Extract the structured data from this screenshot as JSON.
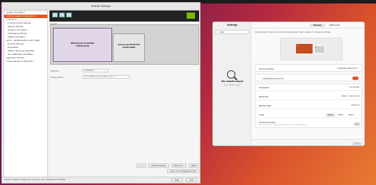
{
  "nvidia": {
    "title": "NVIDIA Settings",
    "sidebar": [
      {
        "label": "System Information",
        "level": 1
      },
      {
        "label": "X Server Display Configuration",
        "level": 1,
        "selected": true
      },
      {
        "label": "X Screen 0",
        "level": 1
      },
      {
        "label": "X Server XVideo Settings",
        "level": 2
      },
      {
        "label": "OpenGL Settings",
        "level": 2
      },
      {
        "label": "Graphics Information",
        "level": 2
      },
      {
        "label": "Antialiasing Settings",
        "level": 2
      },
      {
        "label": "VDPAU Information",
        "level": 2
      },
      {
        "label": "GPU 0 - (NVIDIA GeForce GTX 1660)",
        "level": 1
      },
      {
        "label": "Thermal Settings",
        "level": 2
      },
      {
        "label": "PowerMizer",
        "level": 2
      },
      {
        "label": "HDMI-1 (Samsung S24C550)",
        "level": 2
      },
      {
        "label": "DP-1 (BNQ BenQ PL2460Q)",
        "level": 2
      },
      {
        "label": "Application Profiles",
        "level": 1
      },
      {
        "label": "nvidia-settings Configuration",
        "level": 1
      }
    ],
    "layout_label": "Layout",
    "display1": {
      "name": "BNQ BenQ PL2460Q",
      "res": "2560x1440"
    },
    "display2": {
      "name": "Samsung S24C550",
      "res": "1920x1080"
    },
    "selection_label": "Selection:",
    "selection_value": "X screen 0",
    "configuration_label": "Configuration:",
    "model_value": "DP-1 (BNQ BenQ PL2460Q) (DP-1)",
    "buttons": {
      "apply": "Apply",
      "detect": "Detect Displays",
      "advanced": "Advanced...",
      "reset": "Reset",
      "save": "Save to X Configuration File",
      "help": "Help",
      "quit": "Quit"
    },
    "status_text": "X Server Display Configuration panel for DP-1 (BNQ BenQ PL2460Q)"
  },
  "settings": {
    "left_title": "Settings",
    "search_value": "disp",
    "no_results_title": "No results found",
    "no_results_sub": "Try a different search",
    "tabs": [
      "Displays",
      "Night Light"
    ],
    "intro": "Drag displays to match your physical display setup. Select a display to change its settings.",
    "arr_primary": "1",
    "arr_secondary": "2",
    "primary_label": "Primary Display",
    "primary_value": "1  Ryzen/N America 27\"",
    "display_row_label": "2  Ryzen/N America 27\"",
    "rows": [
      {
        "label": "Orientation",
        "value": "Landscape"
      },
      {
        "label": "Resolution",
        "value": "2560 × 1440 (16:9)"
      },
      {
        "label": "Refresh Rate",
        "value": "59.95 Hz"
      }
    ],
    "scale_label": "Scale",
    "scales": [
      "100 %",
      "200 %",
      "300 %"
    ],
    "fractional_label": "Fractional Scaling",
    "fractional_sub": "May increase power usage, lower speed, or reduce display sharpness.",
    "apply_btn": "Apply"
  },
  "colors": {
    "accent": "#e95420",
    "nvidia_green": "#76b900"
  }
}
